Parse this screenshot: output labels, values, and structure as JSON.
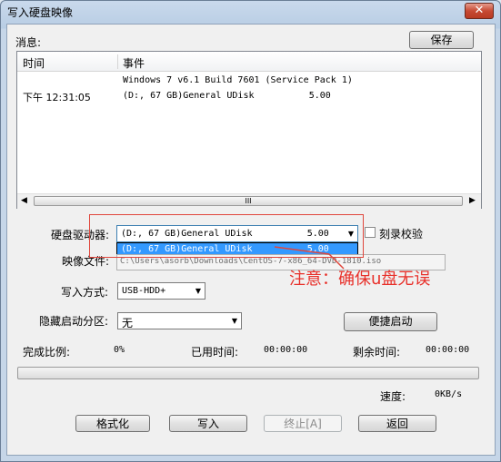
{
  "window": {
    "title": "写入硬盘映像",
    "close_label": "✕"
  },
  "message_label": "消息:",
  "save_button": "保存",
  "log": {
    "col_time": "时间",
    "col_event": "事件",
    "rows": [
      {
        "time": "",
        "event": "Windows 7 v6.1 Build 7601 (Service Pack 1)"
      },
      {
        "time": "下午 12:31:05",
        "event": "(D:, 67 GB)General UDisk          5.00"
      }
    ],
    "scroll_grip": "III"
  },
  "drive": {
    "label": "硬盘驱动器:",
    "selected": "(D:, 67 GB)General UDisk          5.00",
    "option": "(D:, 67 GB)General UDisk          5.00"
  },
  "verify_checkbox": {
    "label": "刻录校验",
    "checked": false
  },
  "image_file": {
    "label": "映像文件:",
    "value": "C:\\Users\\asorb\\Downloads\\CentOS-7-x86_64-DVD-1810.iso"
  },
  "write_mode": {
    "label": "写入方式:",
    "value": "USB-HDD+"
  },
  "hidden_partition": {
    "label": "隐藏启动分区:",
    "value": "无"
  },
  "quick_boot_button": "便捷启动",
  "stats": {
    "percent_label": "完成比例:",
    "percent_value": "0%",
    "elapsed_label": "已用时间:",
    "elapsed_value": "00:00:00",
    "remaining_label": "剩余时间:",
    "remaining_value": "00:00:00",
    "speed_label": "速度:",
    "speed_value": "0KB/s",
    "progress": 0
  },
  "buttons": {
    "format": "格式化",
    "write": "写入",
    "abort": "终止[A]",
    "back": "返回"
  },
  "annotation": "注意：确保u盘无误",
  "colors": {
    "annotation": "#e8302a",
    "selection": "#3399ff"
  }
}
